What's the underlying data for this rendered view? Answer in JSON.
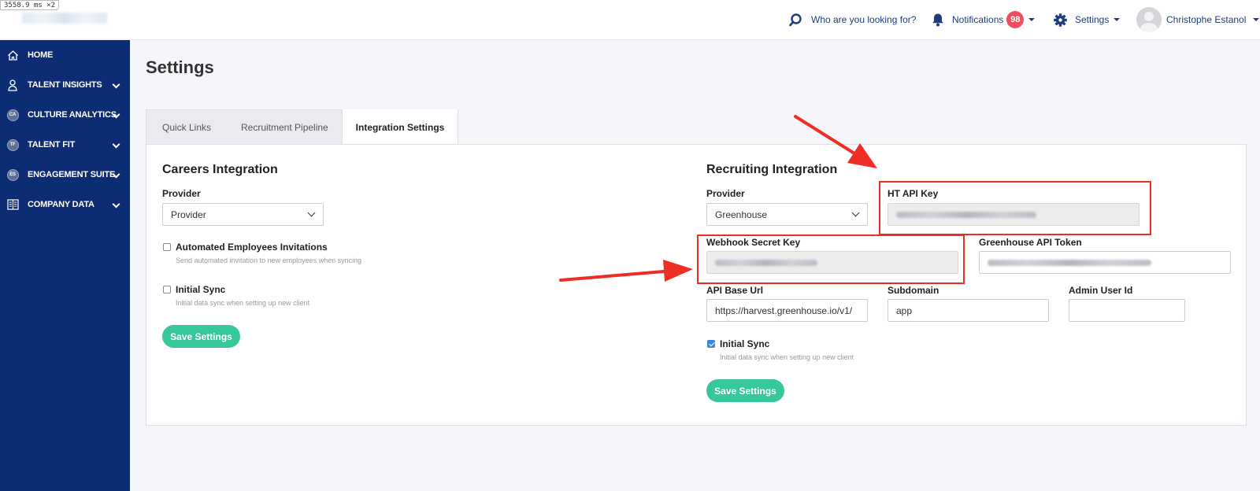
{
  "debug": {
    "timing": "3558.9 ms ×2"
  },
  "header": {
    "search_label": "Who are you looking for?",
    "notifications_label": "Notifications",
    "notifications_count": "98",
    "settings_label": "Settings",
    "user_name": "Christophe Estanol"
  },
  "sidebar": {
    "items": [
      {
        "label": "HOME",
        "icon": "home-icon"
      },
      {
        "label": "TALENT INSIGHTS",
        "icon": "person-icon"
      },
      {
        "label": "CULTURE ANALYTICS",
        "icon": "CA"
      },
      {
        "label": "TALENT FIT",
        "icon": "TF"
      },
      {
        "label": "ENGAGEMENT SUITE",
        "icon": "ES"
      },
      {
        "label": "COMPANY DATA",
        "icon": "book-icon"
      }
    ]
  },
  "page": {
    "title": "Settings",
    "tabs": [
      "Quick Links",
      "Recruitment Pipeline",
      "Integration Settings"
    ],
    "active_tab": "Integration Settings"
  },
  "careers": {
    "title": "Careers Integration",
    "provider_label": "Provider",
    "provider_value": "Provider",
    "auto_invite_label": "Automated Employees Invitations",
    "auto_invite_help": "Send automated invitation to new employees when syncing",
    "auto_invite_checked": false,
    "initial_sync_label": "Initial Sync",
    "initial_sync_help": "Initial data sync when setting up new client",
    "initial_sync_checked": false,
    "save_label": "Save Settings"
  },
  "recruiting": {
    "title": "Recruiting Integration",
    "provider_label": "Provider",
    "provider_value": "Greenhouse",
    "ht_api_key_label": "HT API Key",
    "webhook_secret_label": "Webhook Secret Key",
    "greenhouse_token_label": "Greenhouse API Token",
    "api_base_url_label": "API Base Url",
    "api_base_url_value": "https://harvest.greenhouse.io/v1/",
    "subdomain_label": "Subdomain",
    "subdomain_value": "app",
    "admin_user_id_label": "Admin User Id",
    "admin_user_id_value": "",
    "initial_sync_label": "Initial Sync",
    "initial_sync_help": "Initial data sync when setting up new client",
    "initial_sync_checked": true,
    "save_label": "Save Settings"
  },
  "annotations": {
    "highlight_color": "#ee2e24"
  }
}
